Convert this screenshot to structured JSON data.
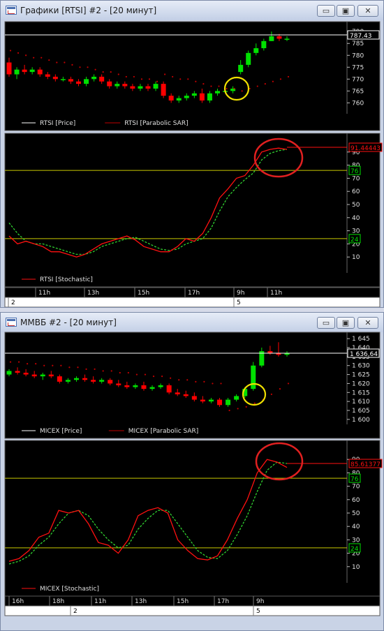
{
  "windows": [
    {
      "title": "Графики [RTSI] #2 - [20 минут]",
      "buttons": {
        "minimize": "▭",
        "restore": "▣",
        "close": "✕"
      },
      "price_panel": {
        "legend": [
          "RTSI [Price]",
          "RTSI [Parabolic SAR]"
        ],
        "y_ticks": [
          "790",
          "785",
          "780",
          "775",
          "770",
          "765",
          "760"
        ],
        "last_price_label": "787.43"
      },
      "stoch_panel": {
        "legend": [
          "RTSI [Stochastic]"
        ],
        "y_ticks": [
          "90",
          "80",
          "70",
          "60",
          "50",
          "40",
          "30",
          "20",
          "10"
        ],
        "value_label": "91.44443",
        "level_high_label": "76",
        "level_low_label": "24"
      },
      "time_axis": {
        "hours": [
          "11h",
          "13h",
          "15h",
          "17h",
          "9h",
          "11h"
        ],
        "days": [
          "2",
          "5"
        ]
      }
    },
    {
      "title": "ММВБ #2 - [20 минут]",
      "buttons": {
        "minimize": "▭",
        "restore": "▣",
        "close": "✕"
      },
      "price_panel": {
        "legend": [
          "MICEX [Price]",
          "MICEX [Parabolic SAR]"
        ],
        "y_ticks": [
          "1 645",
          "1 640",
          "1 635",
          "1 630",
          "1 625",
          "1 620",
          "1 615",
          "1 610",
          "1 605",
          "1 600"
        ],
        "last_price_label": "1 636,64"
      },
      "stoch_panel": {
        "legend": [
          "MICEX [Stochastic]"
        ],
        "y_ticks": [
          "90",
          "80",
          "70",
          "60",
          "50",
          "40",
          "30",
          "20",
          "10"
        ],
        "value_label": "85.61377",
        "level_high_label": "76",
        "level_low_label": "24"
      },
      "time_axis": {
        "hours": [
          "16h",
          "18h",
          "11h",
          "13h",
          "15h",
          "17h",
          "9h"
        ],
        "days": [
          "2",
          "5"
        ]
      }
    }
  ],
  "colors": {
    "up": "#00e000",
    "down": "#ff0000",
    "sar": "#c00000",
    "stoch_main": "#ff1010",
    "stoch_signal": "#30d030",
    "level_line": "#c8c800",
    "highlight_yellow": "#f0e000",
    "highlight_red": "#e02020"
  },
  "chart_data": [
    {
      "type": "candlestick",
      "title": "RTSI [Price]",
      "ylim": [
        756,
        793
      ],
      "series": [
        {
          "name": "RTSI [Price]",
          "ohlc": [
            [
              777,
              779,
              771,
              772
            ],
            [
              772,
              775,
              770,
              774
            ],
            [
              774,
              776,
              772,
              773
            ],
            [
              773,
              775,
              772,
              774
            ],
            [
              774,
              775,
              771,
              772
            ],
            [
              772,
              773,
              770,
              771
            ],
            [
              771,
              772,
              769,
              770
            ],
            [
              770,
              771,
              769,
              770
            ],
            [
              770,
              771,
              768,
              769
            ],
            [
              769,
              770,
              767,
              768
            ],
            [
              768,
              771,
              767,
              770
            ],
            [
              770,
              772,
              769,
              771
            ],
            [
              771,
              772,
              768,
              769
            ],
            [
              769,
              770,
              766,
              767
            ],
            [
              767,
              769,
              766,
              768
            ],
            [
              768,
              769,
              766,
              767
            ],
            [
              767,
              768,
              765,
              766
            ],
            [
              766,
              768,
              765,
              767
            ],
            [
              767,
              768,
              765,
              766
            ],
            [
              766,
              769,
              765,
              768
            ],
            [
              768,
              769,
              762,
              763
            ],
            [
              763,
              764,
              760,
              761
            ],
            [
              761,
              763,
              760,
              762
            ],
            [
              762,
              764,
              761,
              763
            ],
            [
              763,
              765,
              762,
              764
            ],
            [
              764,
              766,
              760,
              761
            ],
            [
              761,
              765,
              760,
              764
            ],
            [
              764,
              766,
              763,
              765
            ],
            [
              765,
              766,
              764,
              765
            ],
            [
              765,
              767,
              764,
              766
            ],
            [
              773,
              778,
              772,
              776
            ],
            [
              776,
              782,
              775,
              781
            ],
            [
              781,
              785,
              780,
              783
            ],
            [
              783,
              787,
              782,
              786
            ],
            [
              786,
              790,
              786,
              788
            ],
            [
              788,
              789,
              786,
              787
            ],
            [
              787,
              788,
              786,
              787
            ]
          ]
        },
        {
          "name": "RTSI [Parabolic SAR]",
          "values": [
            782,
            781,
            780,
            779,
            779,
            778,
            777,
            777,
            776,
            775,
            775,
            774,
            773,
            773,
            772,
            771,
            771,
            770,
            770,
            769,
            772,
            771,
            770,
            770,
            769,
            768,
            767,
            767,
            766,
            766,
            765,
            766,
            767,
            768,
            769,
            770,
            771
          ]
        }
      ]
    },
    {
      "type": "line",
      "title": "RTSI [Stochastic]",
      "ylim": [
        0,
        100
      ],
      "series": [
        {
          "name": "RTSI [Stochastic]",
          "values": [
            26,
            20,
            22,
            20,
            18,
            14,
            14,
            12,
            10,
            12,
            16,
            20,
            22,
            24,
            26,
            23,
            18,
            16,
            14,
            14,
            18,
            24,
            22,
            28,
            40,
            55,
            62,
            70,
            72,
            80,
            90,
            92,
            93,
            92
          ]
        },
        {
          "name": "signal",
          "values": [
            36,
            28,
            22,
            20,
            20,
            18,
            16,
            14,
            12,
            12,
            14,
            18,
            20,
            22,
            24,
            25,
            22,
            19,
            16,
            15,
            16,
            20,
            22,
            24,
            32,
            45,
            56,
            63,
            69,
            74,
            84,
            89,
            91,
            92
          ]
        }
      ],
      "levels": [
        24,
        76
      ]
    },
    {
      "type": "candlestick",
      "title": "MICEX [Price]",
      "ylim": [
        1598,
        1647
      ],
      "series": [
        {
          "name": "MICEX [Price]",
          "ohlc": [
            [
              1625,
              1628,
              1624,
              1627
            ],
            [
              1627,
              1629,
              1625,
              1626
            ],
            [
              1626,
              1628,
              1624,
              1625
            ],
            [
              1625,
              1627,
              1623,
              1624
            ],
            [
              1624,
              1626,
              1622,
              1625
            ],
            [
              1625,
              1627,
              1623,
              1624
            ],
            [
              1624,
              1625,
              1620,
              1621
            ],
            [
              1621,
              1623,
              1620,
              1622
            ],
            [
              1622,
              1624,
              1621,
              1623
            ],
            [
              1623,
              1625,
              1621,
              1622
            ],
            [
              1622,
              1624,
              1620,
              1621
            ],
            [
              1621,
              1623,
              1620,
              1622
            ],
            [
              1622,
              1623,
              1619,
              1620
            ],
            [
              1620,
              1622,
              1618,
              1619
            ],
            [
              1619,
              1621,
              1617,
              1618
            ],
            [
              1618,
              1620,
              1617,
              1619
            ],
            [
              1619,
              1621,
              1616,
              1617
            ],
            [
              1617,
              1619,
              1616,
              1618
            ],
            [
              1618,
              1620,
              1617,
              1619
            ],
            [
              1619,
              1620,
              1614,
              1615
            ],
            [
              1615,
              1617,
              1613,
              1614
            ],
            [
              1614,
              1616,
              1612,
              1613
            ],
            [
              1613,
              1615,
              1610,
              1611
            ],
            [
              1611,
              1613,
              1609,
              1610
            ],
            [
              1610,
              1612,
              1609,
              1611
            ],
            [
              1611,
              1612,
              1607,
              1608
            ],
            [
              1608,
              1612,
              1607,
              1611
            ],
            [
              1611,
              1614,
              1610,
              1613
            ],
            [
              1613,
              1618,
              1612,
              1617
            ],
            [
              1617,
              1632,
              1616,
              1630
            ],
            [
              1630,
              1640,
              1629,
              1638
            ],
            [
              1638,
              1641,
              1636,
              1637
            ],
            [
              1637,
              1643,
              1635,
              1636
            ],
            [
              1636,
              1638,
              1635,
              1637
            ]
          ]
        },
        {
          "name": "MICEX [Parabolic SAR]",
          "values": [
            1632,
            1632,
            1631,
            1631,
            1630,
            1630,
            1630,
            1629,
            1629,
            1628,
            1628,
            1627,
            1627,
            1626,
            1626,
            1625,
            1625,
            1624,
            1624,
            1623,
            1622,
            1622,
            1621,
            1621,
            1620,
            1620,
            1605,
            1606,
            1607,
            1609,
            1611,
            1614,
            1617,
            1620
          ]
        }
      ]
    },
    {
      "type": "line",
      "title": "MICEX [Stochastic]",
      "ylim": [
        0,
        100
      ],
      "series": [
        {
          "name": "MICEX [Stochastic]",
          "values": [
            14,
            16,
            22,
            32,
            35,
            52,
            50,
            52,
            42,
            28,
            26,
            20,
            30,
            48,
            52,
            54,
            50,
            30,
            22,
            16,
            15,
            18,
            30,
            46,
            60,
            80,
            90,
            88,
            84
          ]
        },
        {
          "name": "signal",
          "values": [
            12,
            14,
            18,
            26,
            32,
            42,
            50,
            52,
            48,
            38,
            30,
            24,
            26,
            38,
            46,
            52,
            52,
            42,
            32,
            22,
            17,
            16,
            22,
            34,
            48,
            66,
            82,
            88,
            87
          ]
        }
      ],
      "levels": [
        24,
        76
      ]
    }
  ]
}
